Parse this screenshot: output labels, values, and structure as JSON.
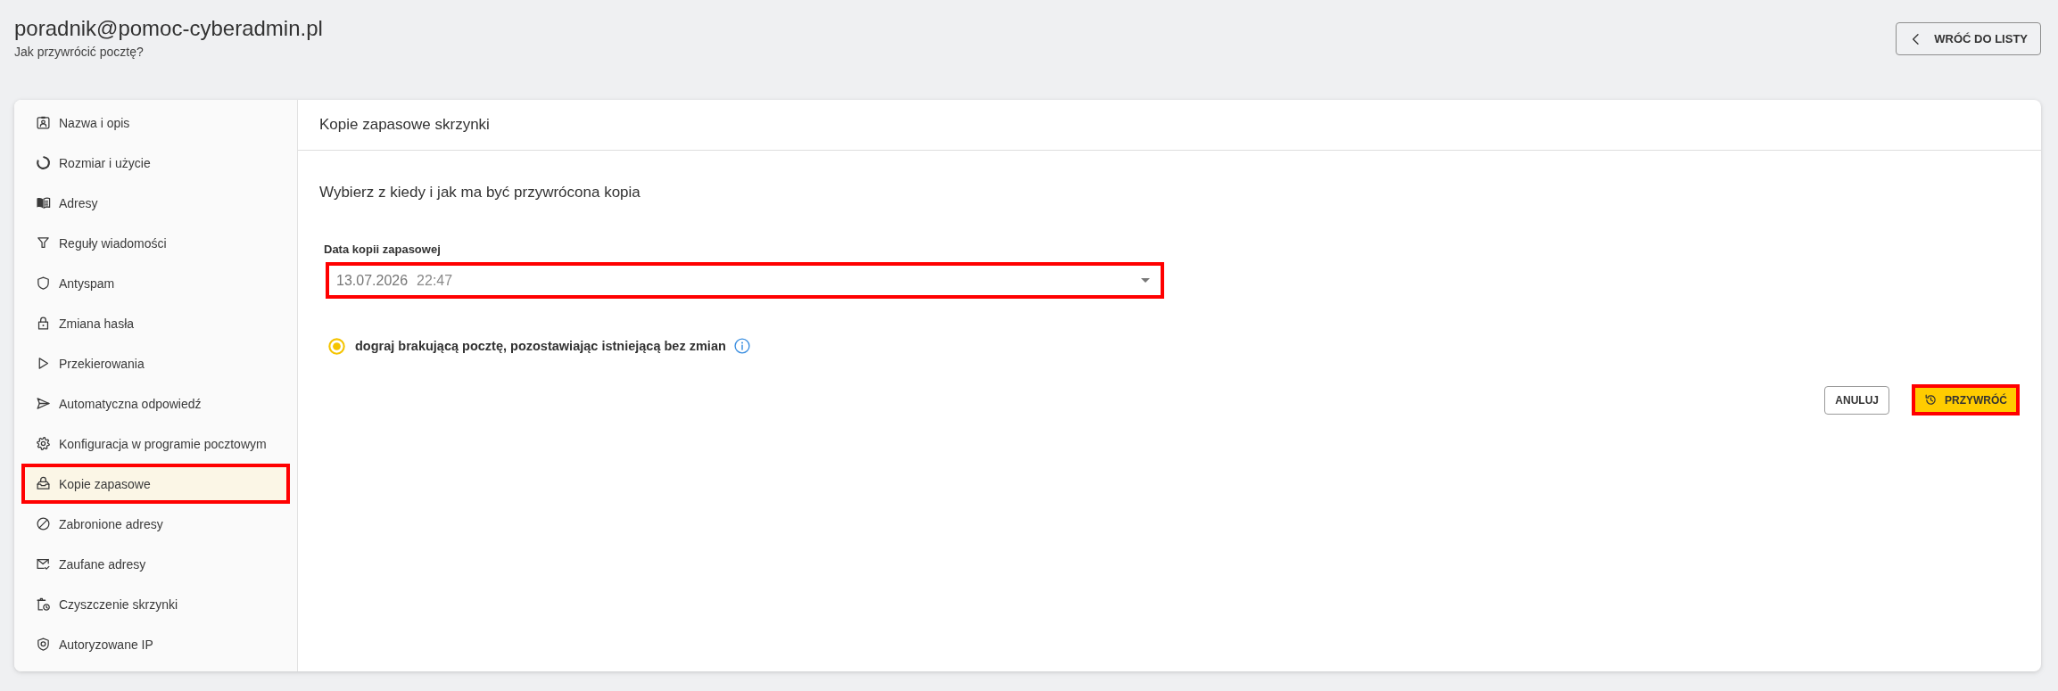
{
  "header": {
    "title": "poradnik@pomoc-cyberadmin.pl",
    "subtitle": "Jak przywrócić pocztę?",
    "back_button": {
      "label": "WRÓĆ DO LISTY"
    }
  },
  "sidebar": {
    "items": [
      {
        "label": "Nazwa i opis",
        "selected": false,
        "highlighted": false
      },
      {
        "label": "Rozmiar i użycie",
        "selected": false,
        "highlighted": false
      },
      {
        "label": "Adresy",
        "selected": false,
        "highlighted": false
      },
      {
        "label": "Reguły wiadomości",
        "selected": false,
        "highlighted": false
      },
      {
        "label": "Antyspam",
        "selected": false,
        "highlighted": false
      },
      {
        "label": "Zmiana hasła",
        "selected": false,
        "highlighted": false
      },
      {
        "label": "Przekierowania",
        "selected": false,
        "highlighted": false
      },
      {
        "label": "Automatyczna odpowiedź",
        "selected": false,
        "highlighted": false
      },
      {
        "label": "Konfiguracja w programie pocztowym",
        "selected": false,
        "highlighted": false
      },
      {
        "label": "Kopie zapasowe",
        "selected": true,
        "highlighted": true
      },
      {
        "label": "Zabronione adresy",
        "selected": false,
        "highlighted": false
      },
      {
        "label": "Zaufane adresy",
        "selected": false,
        "highlighted": false
      },
      {
        "label": "Czyszczenie skrzynki",
        "selected": false,
        "highlighted": false
      },
      {
        "label": "Autoryzowane IP",
        "selected": false,
        "highlighted": false
      }
    ]
  },
  "panel": {
    "title": "Kopie zapasowe skrzynki",
    "intro": "Wybierz z kiedy i jak ma być przywrócona kopia",
    "backup_date": {
      "label": "Data kopii zapasowej",
      "date": "13.07.2026",
      "time": "22:47",
      "highlighted": true
    },
    "options": [
      {
        "label": "dograj brakującą pocztę, pozostawiając istniejącą bez zmian",
        "selected": true
      }
    ],
    "buttons": [
      {
        "label": "ANULUJ",
        "kind": "secondary",
        "highlighted": false
      },
      {
        "label": "PRZYWRÓĆ",
        "kind": "primary",
        "highlighted": true
      }
    ]
  }
}
